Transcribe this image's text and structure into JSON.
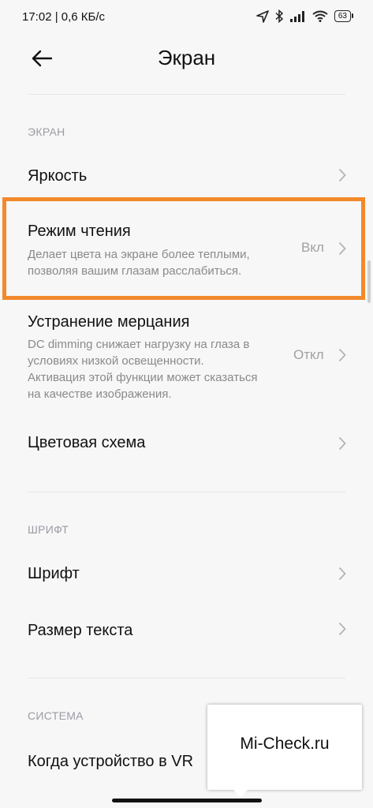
{
  "status_bar": {
    "text": "17:02 | 0,6 КБ/с",
    "battery": "63",
    "icons": [
      "location-icon",
      "bluetooth-icon",
      "signal-icon",
      "wifi-icon",
      "battery-icon"
    ]
  },
  "header": {
    "back_icon": "arrow-left-icon",
    "title": "Экран"
  },
  "sections": {
    "screen": {
      "label": "ЭКРАН",
      "items": [
        {
          "title": "Яркость"
        },
        {
          "title": "Режим чтения",
          "description": "Делает цвета на экране более теплыми, позволяя вашим глазам расслабиться.",
          "value": "Вкл"
        },
        {
          "title": "Устранение мерцания",
          "description": "DC dimming снижает нагрузку на глаза в условиях низкой освещенности. Активация этой функции может сказаться на качестве изображения.",
          "value": "Откл"
        },
        {
          "title": "Цветовая схема"
        }
      ]
    },
    "font": {
      "label": "ШРИФТ",
      "items": [
        {
          "title": "Шрифт"
        },
        {
          "title": "Размер текста"
        }
      ]
    },
    "system": {
      "label": "СИСТЕМА",
      "items": [
        {
          "title": "Когда устройство в VR"
        }
      ]
    }
  },
  "watermark": {
    "text": "Mi-Check.ru"
  },
  "colors": {
    "highlight": "#f2892b",
    "background": "#f7f7f7",
    "secondary_text": "#8a8a8a"
  }
}
